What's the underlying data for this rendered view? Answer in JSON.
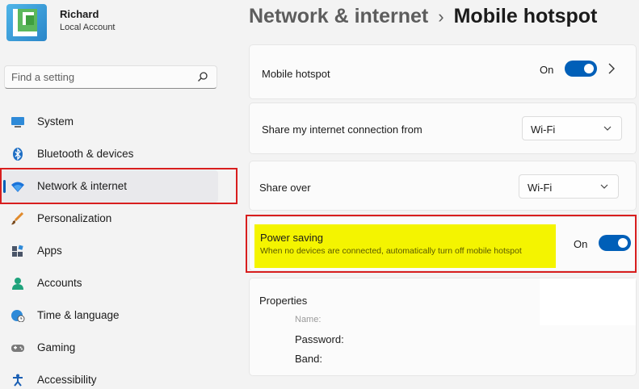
{
  "user": {
    "name": "Richard",
    "account_type": "Local Account"
  },
  "search": {
    "placeholder": "Find a setting"
  },
  "sidebar": {
    "items": [
      {
        "label": "System",
        "icon": "monitor-icon"
      },
      {
        "label": "Bluetooth & devices",
        "icon": "bluetooth-icon"
      },
      {
        "label": "Network & internet",
        "icon": "wifi-icon",
        "active": true
      },
      {
        "label": "Personalization",
        "icon": "brush-icon"
      },
      {
        "label": "Apps",
        "icon": "apps-icon"
      },
      {
        "label": "Accounts",
        "icon": "person-icon"
      },
      {
        "label": "Time & language",
        "icon": "globe-clock-icon"
      },
      {
        "label": "Gaming",
        "icon": "gamepad-icon"
      },
      {
        "label": "Accessibility",
        "icon": "accessibility-icon"
      }
    ]
  },
  "header": {
    "parent": "Network & internet",
    "separator": "›",
    "current": "Mobile hotspot"
  },
  "settings": {
    "mobile_hotspot": {
      "label": "Mobile hotspot",
      "state_text": "On",
      "enabled": true
    },
    "share_from": {
      "label": "Share my internet connection from",
      "value": "Wi-Fi"
    },
    "share_over": {
      "label": "Share over",
      "value": "Wi-Fi"
    },
    "power_saving": {
      "label": "Power saving",
      "description": "When no devices are connected, automatically turn off mobile hotspot",
      "state_text": "On",
      "enabled": true
    },
    "properties": {
      "title": "Properties",
      "faded_key": "Name:",
      "keys": [
        "Password:",
        "Band:"
      ]
    }
  },
  "colors": {
    "accent": "#005fb8",
    "highlight_red": "#d81e1e",
    "highlight_yellow": "#f4f400"
  }
}
